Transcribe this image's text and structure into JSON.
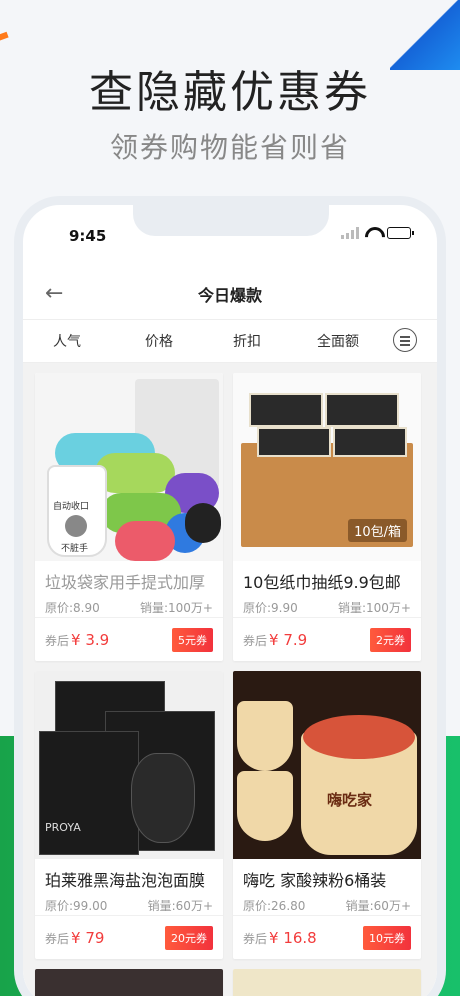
{
  "promo": {
    "title": "查隐藏优惠券",
    "subtitle": "领券购物能省则省"
  },
  "status": {
    "time": "9:45"
  },
  "nav": {
    "back_icon": "arrow-left-icon",
    "title": "今日爆款"
  },
  "sort": {
    "items": [
      "人气",
      "价格",
      "折扣",
      "全面额"
    ],
    "filter_icon": "filter-list-icon"
  },
  "colors": {
    "price": "#f23c3c",
    "coupon": "#f2323c",
    "green": "#18a34a",
    "blue": "#1565d8"
  },
  "products": [
    {
      "title": "垃圾袋家用手提式加厚",
      "original": "原价:8.90",
      "sales": "销量:100万+",
      "after": "券后",
      "price": "¥ 3.9",
      "coupon": "5元券",
      "image_label_1": "自动收口",
      "image_label_2": "不脏手"
    },
    {
      "title": "10包纸巾抽纸9.9包邮",
      "original": "原价:9.90",
      "sales": "销量:100万+",
      "after": "券后",
      "price": "¥ 7.9",
      "coupon": "2元券",
      "image_label_1": "10包/箱"
    },
    {
      "title": "珀莱雅黑海盐泡泡面膜",
      "original": "原价:99.00",
      "sales": "销量:60万+",
      "after": "券后",
      "price": "¥ 79",
      "coupon": "20元券",
      "image_label_1": "PROYA"
    },
    {
      "title": "嗨吃 家酸辣粉6桶装",
      "original": "原价:26.80",
      "sales": "销量:60万+",
      "after": "券后",
      "price": "¥ 16.8",
      "coupon": "10元券",
      "image_label_1": "嗨吃家"
    }
  ]
}
